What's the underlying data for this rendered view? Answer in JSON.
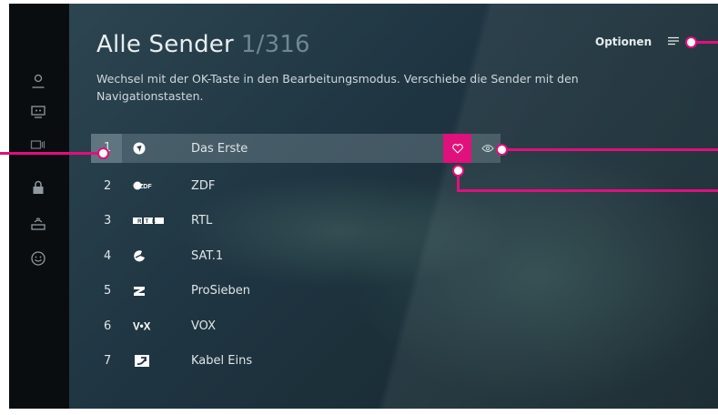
{
  "header": {
    "title": "Alle Sender",
    "count": "1/316"
  },
  "description": "Wechsel mit der OK-Taste in den Bearbeitungsmodus. Verschiebe die Sender mit den Navigationstasten.",
  "options_label": "Optionen",
  "sidebar_icons": [
    "user-icon",
    "recordings-icon",
    "tv-devices-icon",
    "lock-icon",
    "receiver-icon",
    "smiley-icon"
  ],
  "channels": [
    {
      "num": "1",
      "name": "Das Erste",
      "logo": "das-erste-logo"
    },
    {
      "num": "2",
      "name": "ZDF",
      "logo": "zdf-logo"
    },
    {
      "num": "3",
      "name": "RTL",
      "logo": "rtl-logo"
    },
    {
      "num": "4",
      "name": "SAT.1",
      "logo": "sat1-logo"
    },
    {
      "num": "5",
      "name": "ProSieben",
      "logo": "prosieben-logo"
    },
    {
      "num": "6",
      "name": "VOX",
      "logo": "vox-logo"
    },
    {
      "num": "7",
      "name": "Kabel Eins",
      "logo": "kabel-eins-logo"
    }
  ],
  "logo_text": {
    "zdf": "ZDF",
    "rtl": "RTL",
    "vox": "V•X"
  },
  "colors": {
    "accent": "#e20f7c",
    "background": "#1f3542"
  }
}
